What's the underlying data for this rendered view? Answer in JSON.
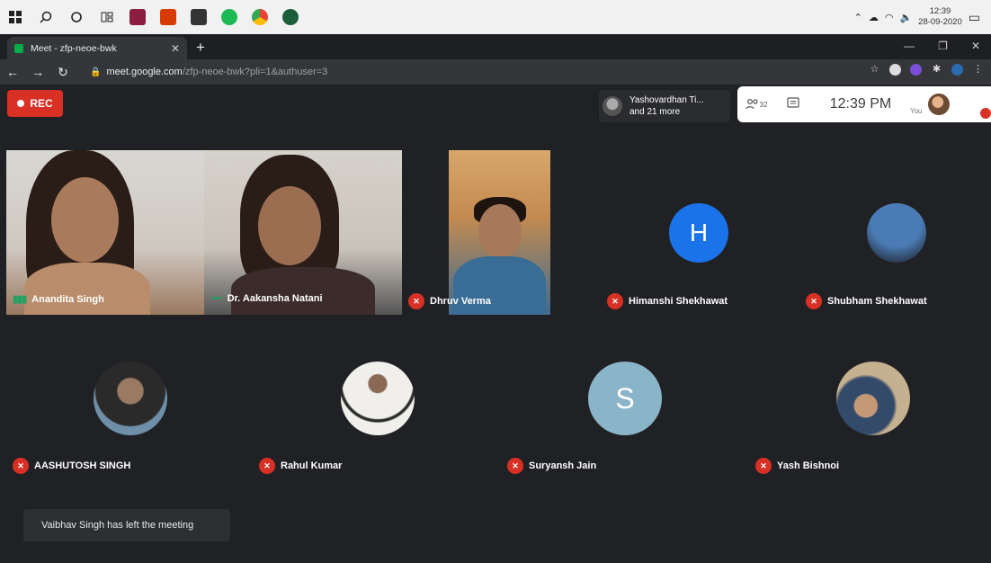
{
  "taskbar": {
    "apps": [
      "windows-logo-icon",
      "search-icon",
      "cortana-icon",
      "task-view-icon",
      "app-icon",
      "office-icon",
      "app-icon",
      "spotify-icon",
      "chrome-icon",
      "app-icon"
    ],
    "clock_time": "12:39",
    "clock_date": "28-09-2020"
  },
  "browser": {
    "tab_title": "Meet - zfp-neoe-bwk",
    "url_host": "meet.google.com",
    "url_path": "/zfp-neoe-bwk?pli=1&authuser=3"
  },
  "meet": {
    "rec_label": "REC",
    "presenter_line1": "Yashovardhan Ti...",
    "presenter_line2": "and 21 more",
    "people_count": "32",
    "time": "12:39 PM",
    "you_label": "You",
    "accent_red": "#d93025",
    "accent_green": "#1ea362"
  },
  "participants": [
    {
      "name": "Anandita Singh",
      "status": "speaking"
    },
    {
      "name": "Dr. Aakansha Natani",
      "status": "active"
    },
    {
      "name": "Dhruv Verma",
      "status": "muted"
    },
    {
      "name": "Himanshi Shekhawat",
      "status": "muted",
      "initial": "H"
    },
    {
      "name": "Shubham Shekhawat",
      "status": "muted"
    },
    {
      "name": "AASHUTOSH SINGH",
      "status": "muted"
    },
    {
      "name": "Rahul Kumar",
      "status": "muted"
    },
    {
      "name": "Suryansh Jain",
      "status": "muted",
      "initial": "S"
    },
    {
      "name": "Yash Bishnoi",
      "status": "muted"
    }
  ],
  "toast": "Vaibhav Singh has left the meeting"
}
